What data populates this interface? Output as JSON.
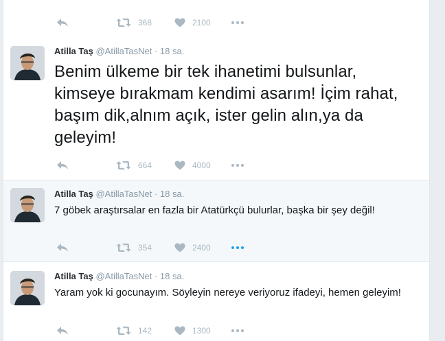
{
  "tweets": [
    {
      "id": "t0",
      "partial": true,
      "actions": {
        "retweets": "368",
        "likes": "2100"
      }
    },
    {
      "id": "t1",
      "fullname": "Atilla Taş",
      "username": "@AtillaTasNet",
      "separator": "·",
      "time": "18 sa.",
      "text": "Benim ülkeme bir tek ihanetimi bulsunlar, kimseye bırakmam kendimi asarım! İçim rahat, başım dik,alnım açık, ister gelin alın,ya da geleyim!",
      "actions": {
        "retweets": "664",
        "likes": "4000"
      }
    },
    {
      "id": "t2",
      "fullname": "Atilla Taş",
      "username": "@AtillaTasNet",
      "separator": "·",
      "time": "18 sa.",
      "text": "7 göbek araştırsalar en fazla bir Atatürkçü bulurlar, başka bir şey değil!",
      "actions": {
        "retweets": "354",
        "likes": "2400"
      }
    },
    {
      "id": "t3",
      "fullname": "Atilla Taş",
      "username": "@AtillaTasNet",
      "separator": "·",
      "time": "18 sa.",
      "text": "Yaram yok ki gocunayım. Söyleyin nereye veriyoruz ifadeyi, hemen geleyim!",
      "actions": {
        "retweets": "142",
        "likes": "1300"
      }
    }
  ],
  "colors": {
    "icon": "#aab8c2",
    "accent": "#1da1f2",
    "border": "#e1e8ed",
    "hover_bg": "#f5f8fa"
  },
  "icons": {
    "reply": "reply-icon",
    "retweet": "retweet-icon",
    "like": "heart-icon",
    "more": "more-dots-icon"
  }
}
